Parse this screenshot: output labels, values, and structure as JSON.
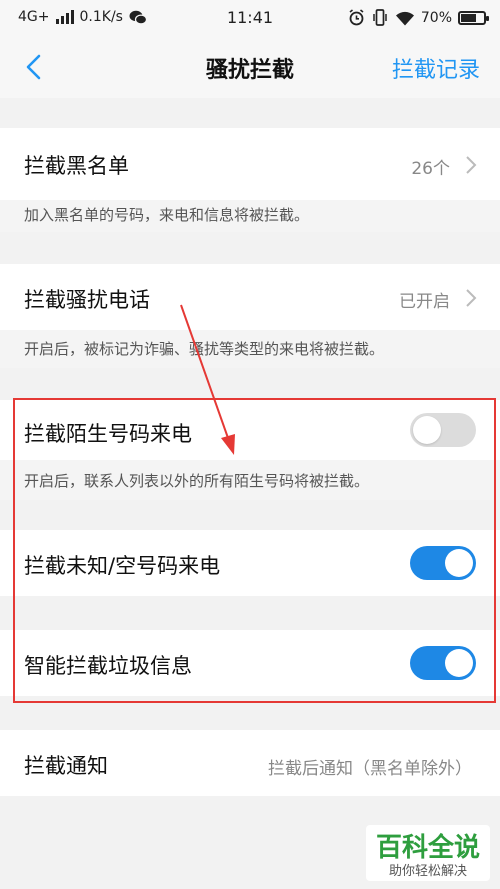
{
  "status_bar": {
    "network": "4G+",
    "speed": "0.1K/s",
    "time": "11:41",
    "battery": "70%",
    "battery_level": 0.7,
    "icons": [
      "signal-icon",
      "wechat-icon",
      "alarm-icon",
      "vibrate-icon",
      "wifi-icon",
      "battery-icon"
    ]
  },
  "nav": {
    "back_icon": "chevron-left-icon",
    "title": "骚扰拦截",
    "right_action": "拦截记录"
  },
  "settings": [
    {
      "title": "拦截黑名单",
      "value": "26个",
      "description": "加入黑名单的号码，来电和信息将被拦截。"
    },
    {
      "title": "拦截骚扰电话",
      "value": "已开启",
      "description": "开启后，被标记为诈骗、骚扰等类型的来电将被拦截。"
    },
    {
      "title": "拦截陌生号码来电",
      "toggle_on": false,
      "description": "开启后，联系人列表以外的所有陌生号码将被拦截。"
    },
    {
      "title": "拦截未知/空号码来电",
      "toggle_on": true
    },
    {
      "title": "智能拦截垃圾信息",
      "toggle_on": true
    },
    {
      "title": "拦截通知",
      "value": "拦截后通知（黑名单除外）"
    }
  ],
  "watermark": {
    "brand": "百科全说",
    "slogan": "助你轻松解决"
  },
  "colors": {
    "accent": "#2196f3",
    "toggle_on": "#1e88e5",
    "toggle_off": "#dcdcdc",
    "annotation": "#e53935"
  }
}
